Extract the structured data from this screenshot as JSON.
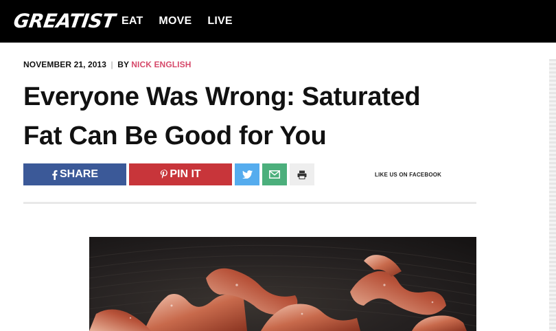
{
  "header": {
    "logo": "GREATIST",
    "nav": [
      "EAT",
      "MOVE",
      "LIVE"
    ]
  },
  "article": {
    "date": "NOVEMBER 21, 2013",
    "separator": "|",
    "by_label": "BY",
    "author": "NICK ENGLISH",
    "title": "Everyone Was Wrong: Saturated Fat Can Be Good for You"
  },
  "share": {
    "facebook_label": "SHARE",
    "pinterest_label": "PIN IT",
    "like_facebook": "LIKE US ON FACEBOOK"
  },
  "icons": {
    "facebook": "facebook-icon",
    "pinterest": "pinterest-icon",
    "twitter": "twitter-icon",
    "email": "envelope-icon",
    "print": "printer-icon"
  },
  "colors": {
    "facebook": "#3b5998",
    "pinterest": "#c8353a",
    "twitter": "#55acee",
    "email": "#4caf7c",
    "author": "#d6496a"
  }
}
